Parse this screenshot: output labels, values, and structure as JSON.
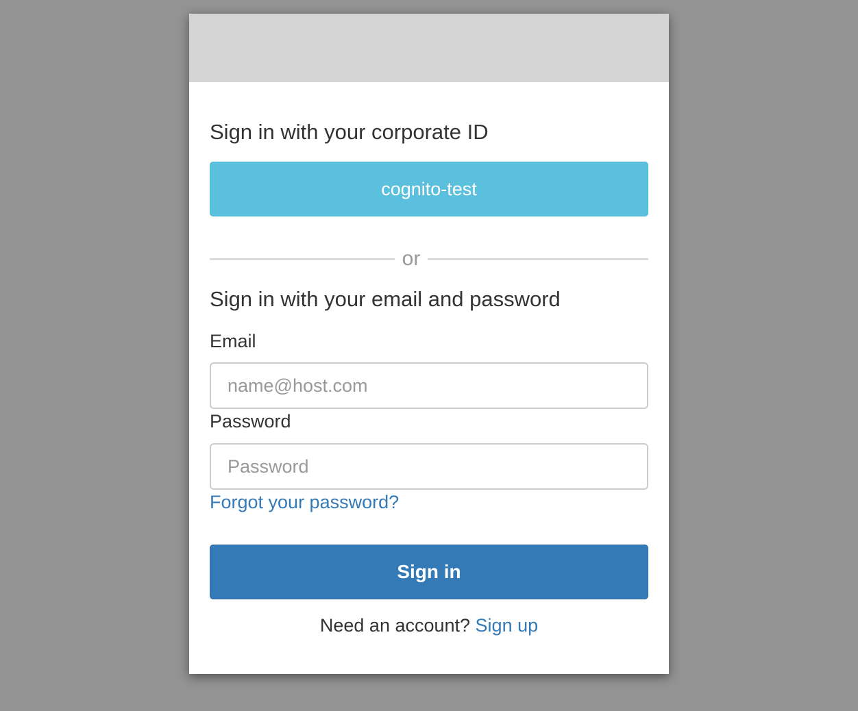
{
  "colors": {
    "backdrop": "#939393",
    "banner": "#d4d4d4",
    "idp_button": "#5bc0de",
    "primary_button": "#337ab7",
    "link": "#337ab7",
    "text": "#333333",
    "muted": "#999999"
  },
  "corporate": {
    "heading": "Sign in with your corporate ID",
    "idp_button_label": "cognito-test"
  },
  "divider": {
    "text": "or"
  },
  "credentials": {
    "heading": "Sign in with your email and password",
    "email_label": "Email",
    "email_placeholder": "name@host.com",
    "password_label": "Password",
    "password_placeholder": "Password",
    "forgot_link": "Forgot your password?",
    "signin_button": "Sign in"
  },
  "footer": {
    "prompt": "Need an account?",
    "signup_link": "Sign up"
  }
}
